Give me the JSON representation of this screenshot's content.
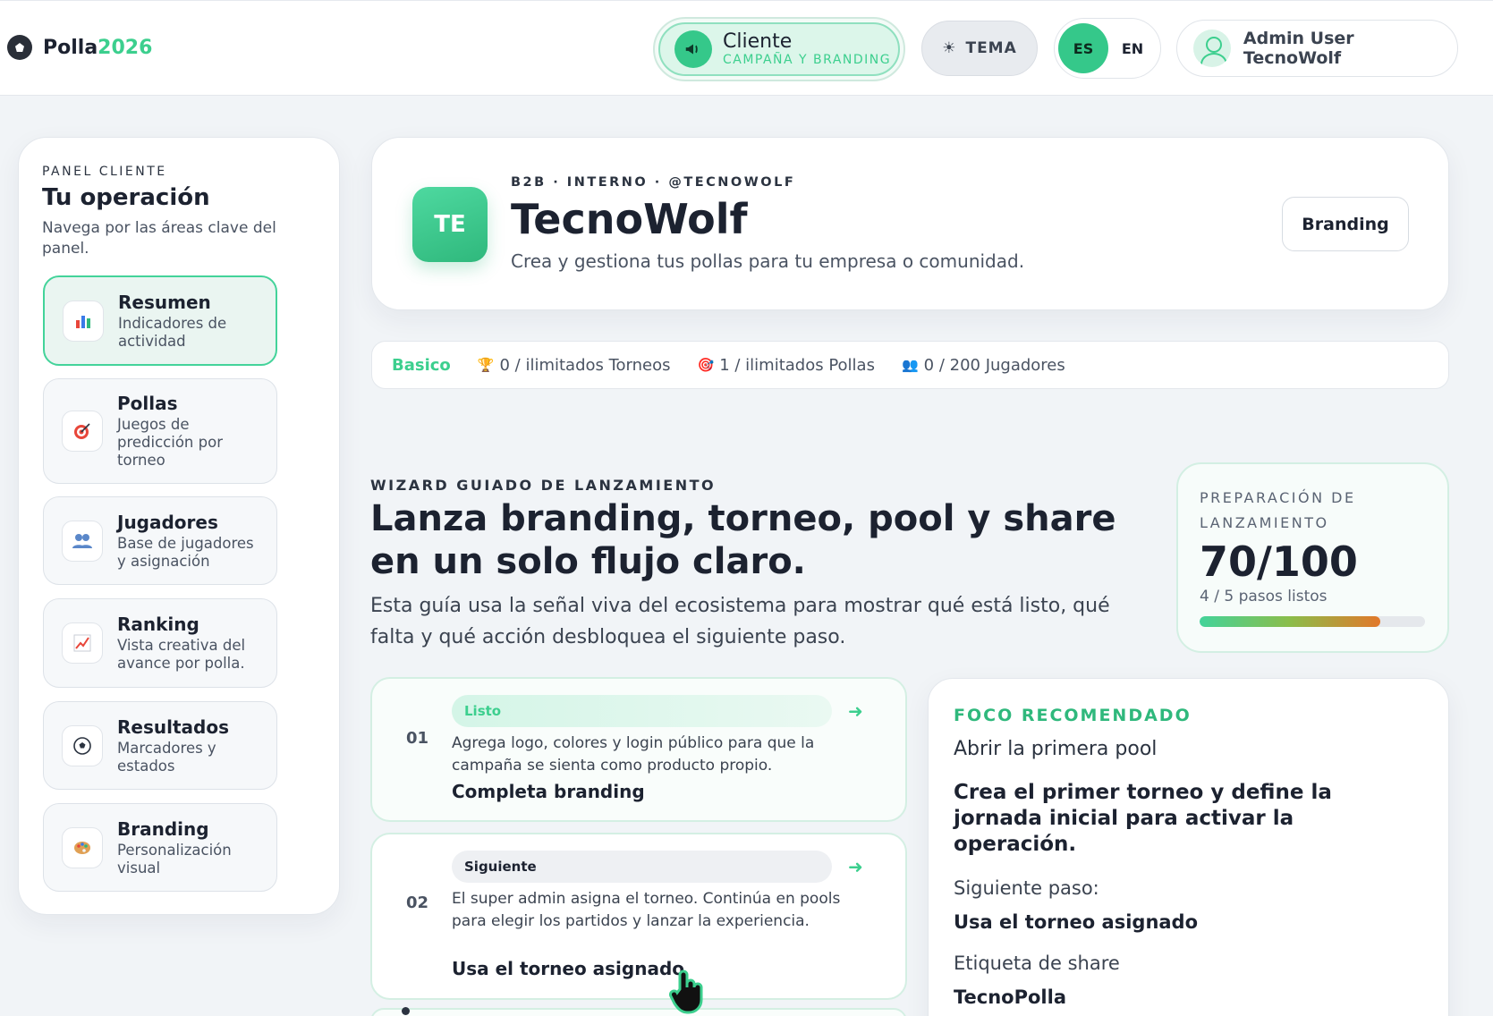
{
  "brand": {
    "name": "Polla",
    "year": "2026"
  },
  "topbar": {
    "client_title": "Cliente",
    "client_sub": "CAMPAÑA Y BRANDING",
    "theme_label": "TEMA",
    "lang_es": "ES",
    "lang_en": "EN",
    "user_name": "Admin User TecnoWolf"
  },
  "sidebar": {
    "eyebrow": "PANEL CLIENTE",
    "title": "Tu operación",
    "desc": "Navega por las áreas clave del panel.",
    "items": [
      {
        "title": "Resumen",
        "sub": "Indicadores de actividad",
        "icon": "bar-chart-icon"
      },
      {
        "title": "Pollas",
        "sub": "Juegos de predicción por torneo",
        "icon": "target-icon"
      },
      {
        "title": "Jugadores",
        "sub": "Base de jugadores y asignación",
        "icon": "people-icon"
      },
      {
        "title": "Ranking",
        "sub": "Vista creativa del avance por polla.",
        "icon": "trend-chart-icon"
      },
      {
        "title": "Resultados",
        "sub": "Marcadores y estados",
        "icon": "soccer-ball-icon"
      },
      {
        "title": "Branding",
        "sub": "Personalización visual",
        "icon": "palette-icon"
      }
    ]
  },
  "org": {
    "initials": "TE",
    "eyebrow": "B2B · INTERNO · @TECNOWOLF",
    "name": "TecnoWolf",
    "tagline": "Crea y gestiona tus pollas para tu empresa o comunidad.",
    "branding_button": "Branding"
  },
  "plan": {
    "name": "Basico",
    "tournaments": "0 / ilimitados Torneos",
    "pools": "1 / ilimitados Pollas",
    "players": "0 / 200 Jugadores"
  },
  "wizard": {
    "eyebrow": "WIZARD GUIADO DE LANZAMIENTO",
    "title": "Lanza branding, torneo, pool y share en un solo flujo claro.",
    "desc": "Esta guía usa la señal viva del ecosistema para mostrar qué está listo, qué falta y qué acción desbloquea el siguiente paso."
  },
  "readiness": {
    "eyebrow": "PREPARACIÓN DE LANZAMIENTO",
    "score": "70/100",
    "steps": "4 / 5 pasos listos",
    "progress": 0.8,
    "colors": [
      "#43d39a",
      "#8bbd4a",
      "#e2782a"
    ]
  },
  "steps": [
    {
      "num": "01",
      "badge": "Listo",
      "desc": "Agrega logo, colores y login público para que la campaña se sienta como producto propio.",
      "action": "Completa branding"
    },
    {
      "num": "02",
      "badge": "Siguiente",
      "desc": "El super admin asigna el torneo. Continúa en pools para elegir los partidos y lanzar la experiencia.",
      "action": "Usa el torneo asignado"
    }
  ],
  "focus": {
    "eyebrow": "FOCO RECOMENDADO",
    "item": "Abrir la primera pool",
    "lead": "Crea el primer torneo y define la jornada inicial para activar la operación.",
    "next_label": "Siguiente paso:",
    "next_value": "Usa el torneo asignado",
    "share_label": "Etiqueta de share",
    "share_value": "TecnoPolla"
  },
  "colors": {
    "accent": "#3ccf8e",
    "text": "#1c2230"
  }
}
